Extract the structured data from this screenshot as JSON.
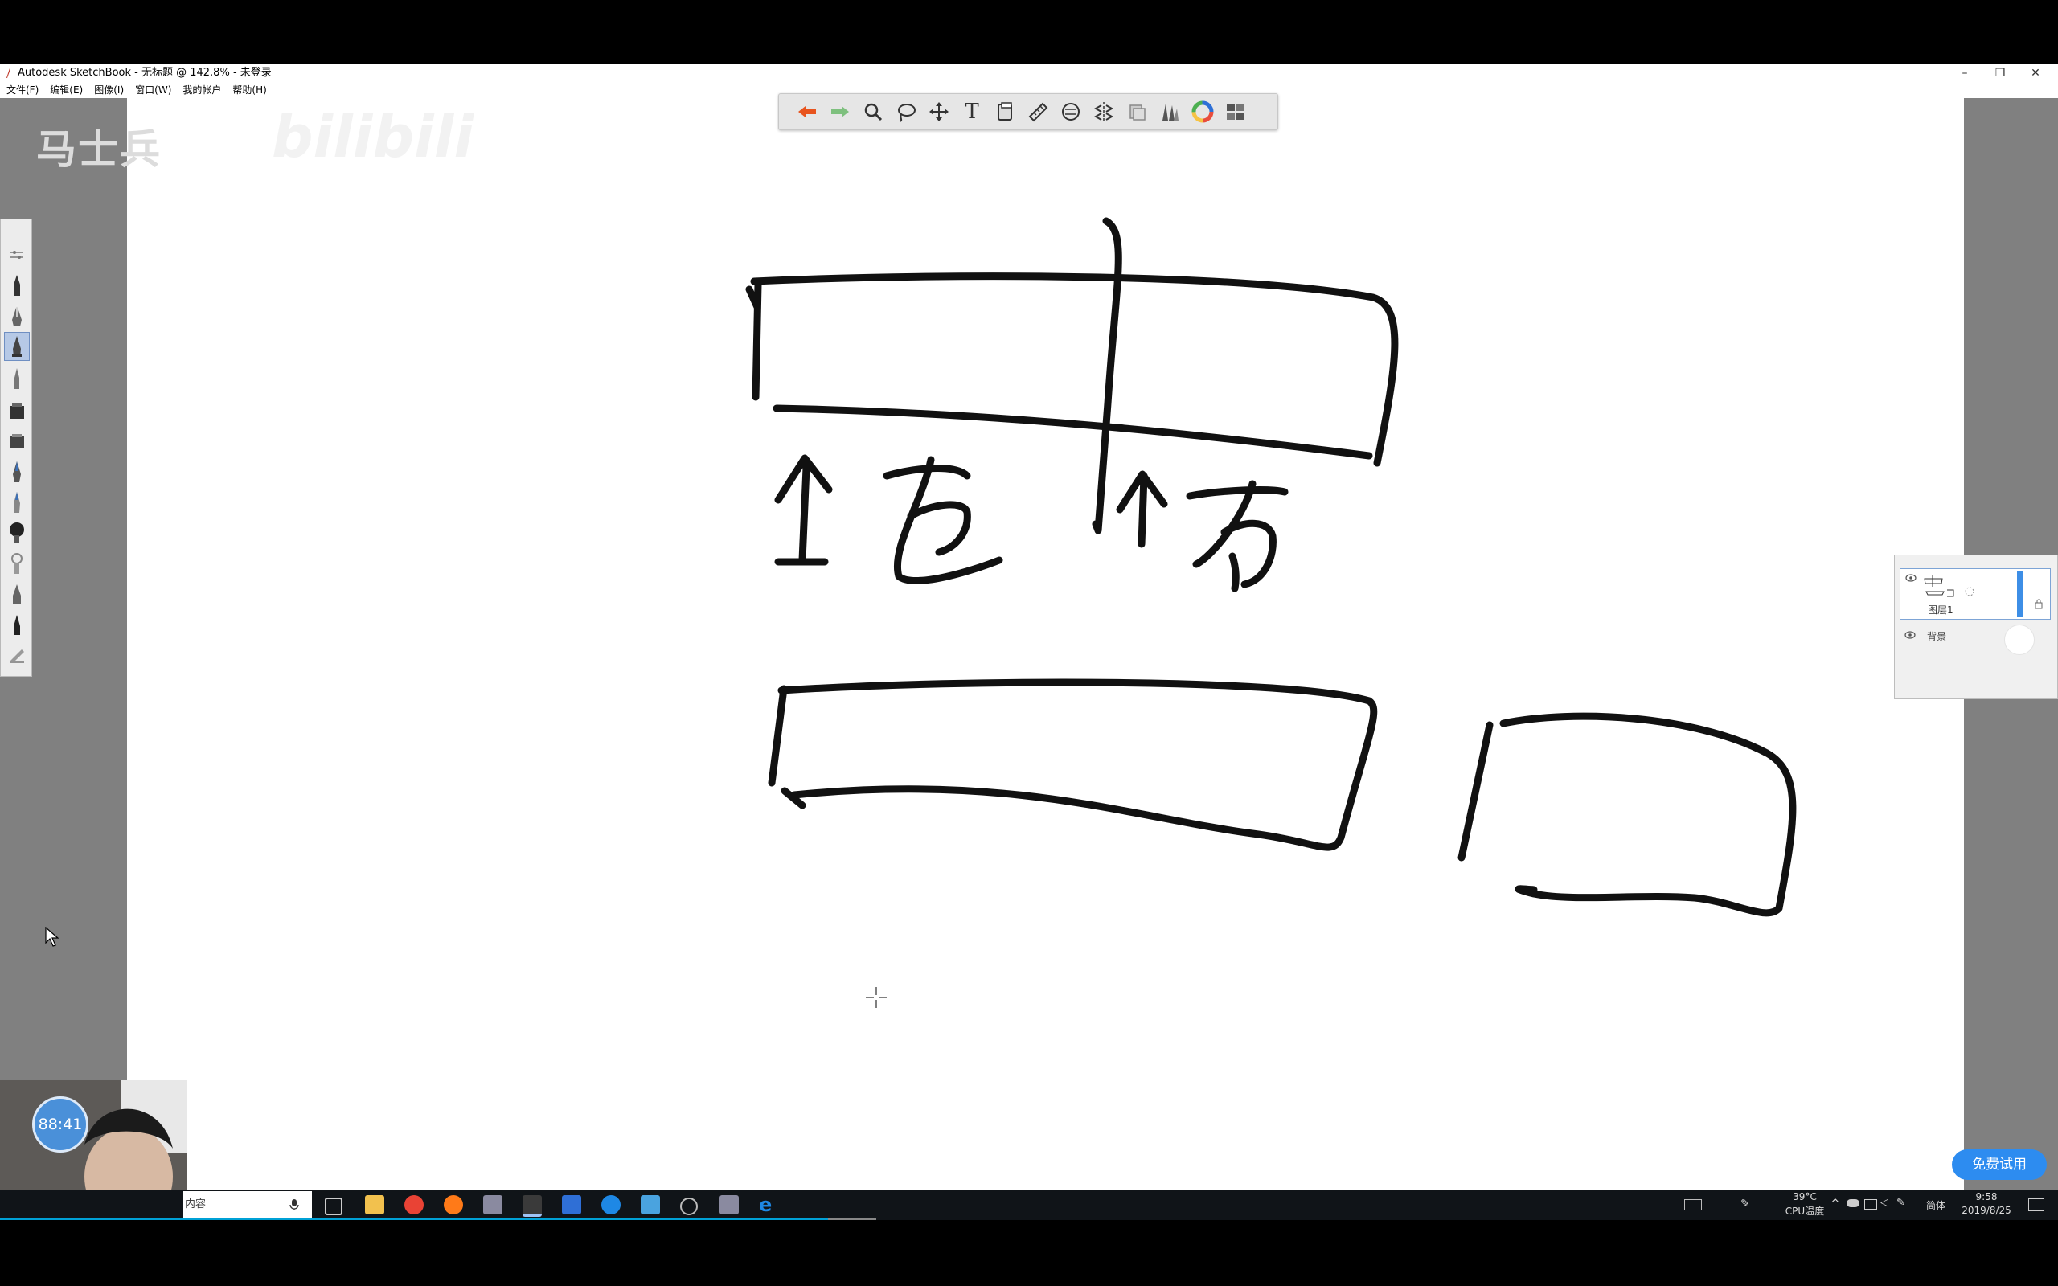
{
  "window": {
    "title": "Autodesk SketchBook - 无标题 @ 142.8% - 未登录",
    "controls": [
      "–",
      "❐",
      "✕"
    ]
  },
  "menubar": {
    "items": [
      "文件(F)",
      "编辑(E)",
      "图像(I)",
      "窗口(W)",
      "我的帐户",
      "帮助(H)"
    ]
  },
  "watermark": {
    "text": "马士兵",
    "logo": "bilibili"
  },
  "toolbar": {
    "tools": [
      "undo-icon",
      "redo-icon",
      "zoom-icon",
      "lasso-icon",
      "move-icon",
      "text-icon",
      "crop-icon",
      "ruler-icon",
      "ellipse-guide-icon",
      "symmetry-icon",
      "stamp-icon",
      "brush-library-icon",
      "color-wheel-icon",
      "layers-icon"
    ],
    "text_tool_label": "T"
  },
  "canvas": {
    "handwriting": [
      "左",
      "右"
    ]
  },
  "layers": {
    "layer1_name": "图层1",
    "background_name": "背景"
  },
  "webcam": {
    "timer": "88:41"
  },
  "trial_button": "免费试用",
  "taskbar": {
    "search_text": "内容",
    "temp": "39°C",
    "temp_label": "CPU温度",
    "ime": "简体",
    "time": "9:58",
    "date": "2019/8/25"
  },
  "colors": {
    "canvas": "#ffffff",
    "workspace": "#808080",
    "undo": "#e8541e",
    "redo": "#7ec07e",
    "accent": "#2d8cf0"
  }
}
